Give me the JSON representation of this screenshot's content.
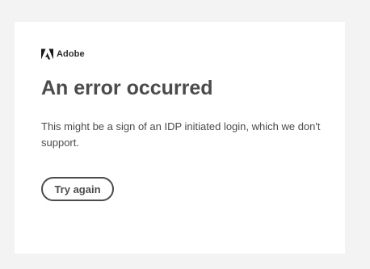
{
  "brand": {
    "name": "Adobe",
    "logo_icon": "adobe-logo-icon",
    "logo_color": "#1a1a1a"
  },
  "error": {
    "title": "An error occurred",
    "message": "This might be a sign of an IDP initiated login, which we don't support."
  },
  "actions": {
    "retry_label": "Try again"
  },
  "colors": {
    "page_background": "#f3f3f3",
    "card_background": "#ffffff",
    "text": "#4b4b4b"
  }
}
